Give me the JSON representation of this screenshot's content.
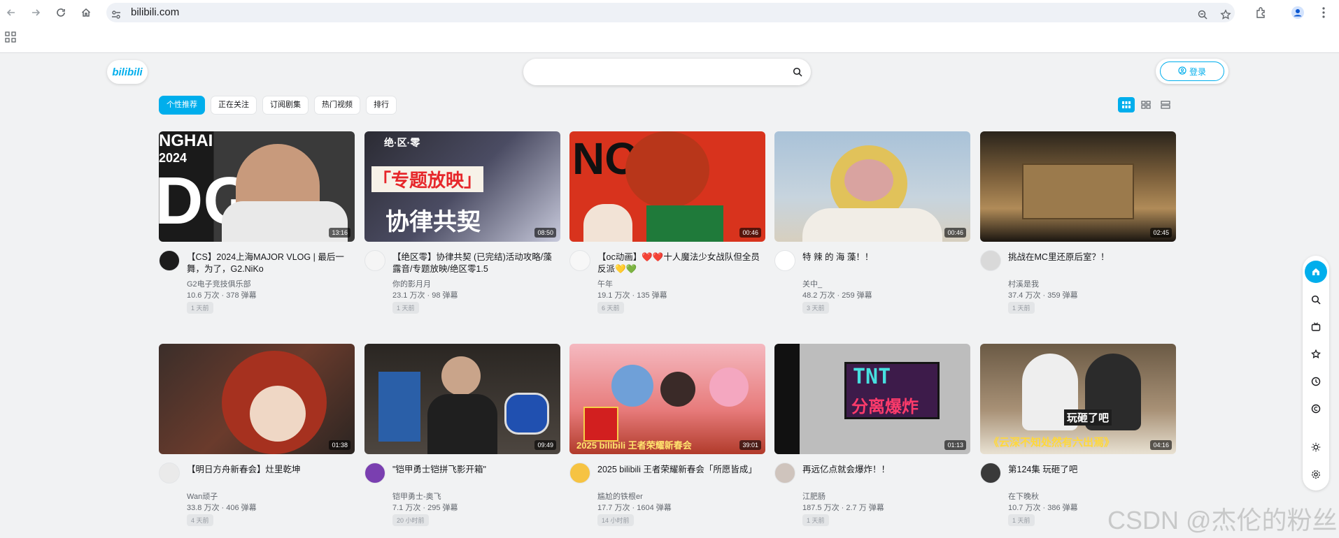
{
  "browser": {
    "url": "bilibili.com",
    "back_icon": "arrow-left-icon",
    "forward_icon": "arrow-right-icon",
    "reload_icon": "reload-icon",
    "home_icon": "home-icon",
    "apps_icon": "apps-grid-icon"
  },
  "header": {
    "logo_text": "bilibili",
    "search": {
      "placeholder": "",
      "value": ""
    },
    "login_label": "登录"
  },
  "tabs": [
    {
      "label": "个性推荐",
      "active": true
    },
    {
      "label": "正在关注",
      "active": false
    },
    {
      "label": "订阅剧集",
      "active": false
    },
    {
      "label": "热门视频",
      "active": false
    },
    {
      "label": "排行",
      "active": false
    }
  ],
  "colors": {
    "accent": "#00aeec"
  },
  "videos": [
    {
      "title": "【CS】2024上海MAJOR VLOG | 最后一舞，为了，G2.NiKo",
      "uploader": "G2电子竞技俱乐部",
      "stats": "10.6 万次 · 378 弹幕",
      "time": "1 天前",
      "duration": "13:16"
    },
    {
      "title": "【绝区零】协律共契 (已完结)活动攻略/藻露音/专题放映/绝区零1.5",
      "uploader": "你的影月月",
      "stats": "23.1 万次 · 98 弹幕",
      "time": "1 天前",
      "duration": "08:50"
    },
    {
      "title": "【oc动画】❤️❤️十人魔法少女战队但全员反派💛💚",
      "uploader": "午年",
      "stats": "19.1 万次 · 135 弹幕",
      "time": "6 天前",
      "duration": "00:46"
    },
    {
      "title": "特 辣 的 海 藻！！",
      "uploader": "关中_",
      "stats": "48.2 万次 · 259 弹幕",
      "time": "3 天前",
      "duration": "00:46"
    },
    {
      "title": "挑战在MC里还原后室？！",
      "uploader": "村溪是我",
      "stats": "37.4 万次 · 359 弹幕",
      "time": "1 天前",
      "duration": "02:45"
    },
    {
      "title": "【明日方舟新春会】灶里乾坤",
      "uploader": "Wan顽子",
      "stats": "33.8 万次 · 406 弹幕",
      "time": "4 天前",
      "duration": "01:38"
    },
    {
      "title": "\"铠甲勇士铠拼飞影开箱\"",
      "uploader": "铠甲勇士-奥飞",
      "stats": "7.1 万次 · 295 弹幕",
      "time": "20 小时前",
      "duration": "09:49"
    },
    {
      "title": "2025 bilibili 王者荣耀新春会「所愿皆成」",
      "uploader": "尴尬的铁根er",
      "stats": "17.7 万次 · 1604 弹幕",
      "time": "14 小时前",
      "duration": "39:01"
    },
    {
      "title": "再远亿点就会爆炸！！",
      "uploader": "江肥肠",
      "stats": "187.5 万次 · 2.7 万 弹幕",
      "time": "1 天前",
      "duration": "01:13"
    },
    {
      "title": "第124集 玩砸了吧",
      "uploader": "在下晚秋",
      "stats": "10.7 万次 · 386 弹幕",
      "time": "1 天前",
      "duration": "04:16"
    }
  ],
  "thumb_text": {
    "t1": "NGHAI",
    "t1b": "2024",
    "t1c": "DG",
    "t2a": "绝·区·零",
    "t2b": "「专题放映」",
    "t2c": "协律共契",
    "t3": "NO",
    "t8": "2025 bilibili 王者荣耀新春会",
    "t9a": "TNT",
    "t9b": "分离爆炸",
    "t10a": "玩砸了吧",
    "t10b": "《云深不知处然有六出焉》"
  },
  "watermark": "CSDN @杰伦的粉丝"
}
